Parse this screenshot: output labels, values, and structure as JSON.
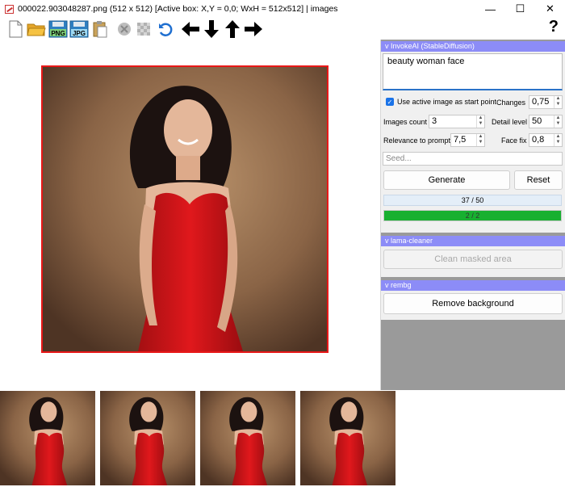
{
  "window": {
    "title": "000022.903048287.png (512 x 512) [Active box: X,Y = 0,0; WxH = 512x512] | images",
    "minimize": "—",
    "maximize": "☐",
    "close": "✕"
  },
  "toolbar": {
    "icons": [
      "new-file-icon",
      "open-folder-icon",
      "save-png-icon",
      "save-jpg-icon",
      "paste-icon",
      "delete-icon",
      "crop-icon",
      "undo-icon",
      "arrow-left-icon",
      "arrow-down-icon",
      "arrow-up-icon",
      "arrow-right-icon"
    ],
    "png_label": "PNG",
    "jpg_label": "JPG",
    "help": "?"
  },
  "invoke": {
    "header": "v InvokeAI (StableDiffusion)",
    "prompt": "beauty woman face",
    "use_active_label": "Use active image as start point",
    "use_active_checked": true,
    "changes_label": "Changes",
    "changes_value": "0,75",
    "images_count_label": "Images count",
    "images_count_value": "3",
    "detail_level_label": "Detail level",
    "detail_level_value": "50",
    "relevance_label": "Relevance to prompt",
    "relevance_value": "7,5",
    "face_fix_label": "Face fix",
    "face_fix_value": "0,8",
    "seed_placeholder": "Seed...",
    "generate_label": "Generate",
    "reset_label": "Reset",
    "progress_steps_text": "37 / 50",
    "progress_steps_fraction": 0.74,
    "progress_images_text": "2 / 2",
    "progress_images_fraction": 1.0
  },
  "lama": {
    "header": "v lama-cleaner",
    "clean_label": "Clean masked area"
  },
  "rembg": {
    "header": "v rembg",
    "remove_label": "Remove background"
  },
  "colors": {
    "selection_border": "#e81818",
    "section_header": "#8c8cf7",
    "progress_green": "#18b030",
    "accent_blue": "#1a73e8"
  },
  "thumbnails_count": 4
}
